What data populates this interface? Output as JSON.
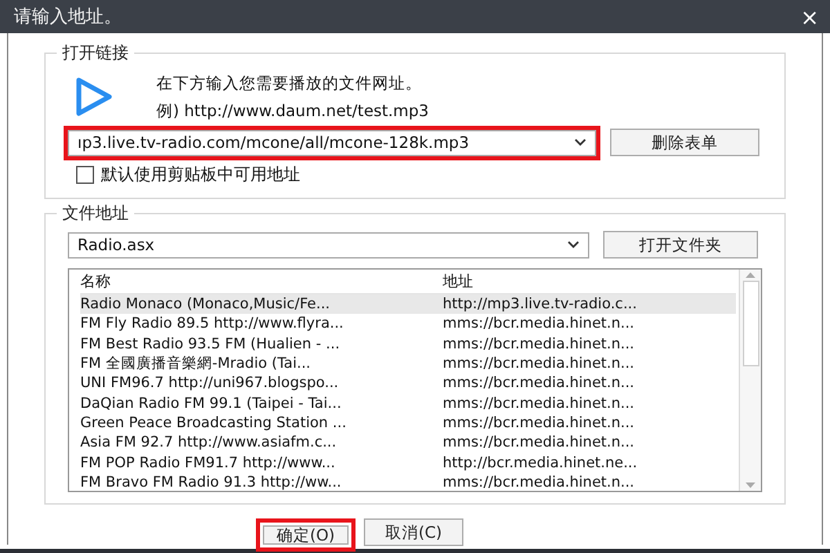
{
  "window": {
    "title": "请输入地址。",
    "close": "×"
  },
  "open_link": {
    "legend": "打开链接",
    "hint": "在下方输入您需要播放的文件网址。",
    "example": "例) http://www.daum.net/test.mp3",
    "url": {
      "value": "ıp3.live.tv-radio.com/mcone/all/mcone-128k.mp3",
      "highlighted": true
    },
    "clear_button": "删除表单",
    "clipboard": {
      "label": "默认使用剪贴板中可用地址",
      "checked": false
    }
  },
  "file_address": {
    "legend": "文件地址",
    "file": {
      "value": "Radio.asx"
    },
    "open_folder_button": "打开文件夹",
    "table": {
      "columns": [
        "名称",
        "地址"
      ],
      "rows": [
        {
          "cells": [
            "Radio Monaco (Monaco,Music/Fe...",
            "http://mp3.live.tv-radio.c..."
          ],
          "selected": true
        },
        {
          "cells": [
            "FM Fly Radio 89.5 http://www.flyra...",
            "mms://bcr.media.hinet.n..."
          ],
          "selected": false
        },
        {
          "cells": [
            "FM Best Radio 93.5 FM (Hualien - ...",
            "mms://bcr.media.hinet.n..."
          ],
          "selected": false
        },
        {
          "cells": [
            "FM 全國廣播音樂網-Mradio (Tai...",
            "mms://bcr.media.hinet.n..."
          ],
          "selected": false
        },
        {
          "cells": [
            "UNI FM96.7 http://uni967.blogspo...",
            "mms://bcr.media.hinet.n..."
          ],
          "selected": false
        },
        {
          "cells": [
            "DaQian Radio FM 99.1 (Taipei - Tai...",
            "mms://bcr.media.hinet.n..."
          ],
          "selected": false
        },
        {
          "cells": [
            "Green Peace Broadcasting Station ...",
            "mms://bcr.media.hinet.n..."
          ],
          "selected": false
        },
        {
          "cells": [
            "Asia FM 92.7 http://www.asiafm.c...",
            "mms://bcr.media.hinet.n..."
          ],
          "selected": false
        },
        {
          "cells": [
            "FM POP Radio FM91.7 http://www...",
            "http://bcr.media.hinet.ne..."
          ],
          "selected": false
        },
        {
          "cells": [
            "FM Bravo FM Radio 91.3 http://ww...",
            "mms://bcr.media.hinet.n..."
          ],
          "selected": false
        }
      ]
    }
  },
  "buttons": [
    {
      "label": "确定(O)",
      "highlighted": true
    },
    {
      "label": "取消(C)",
      "highlighted": false
    }
  ]
}
